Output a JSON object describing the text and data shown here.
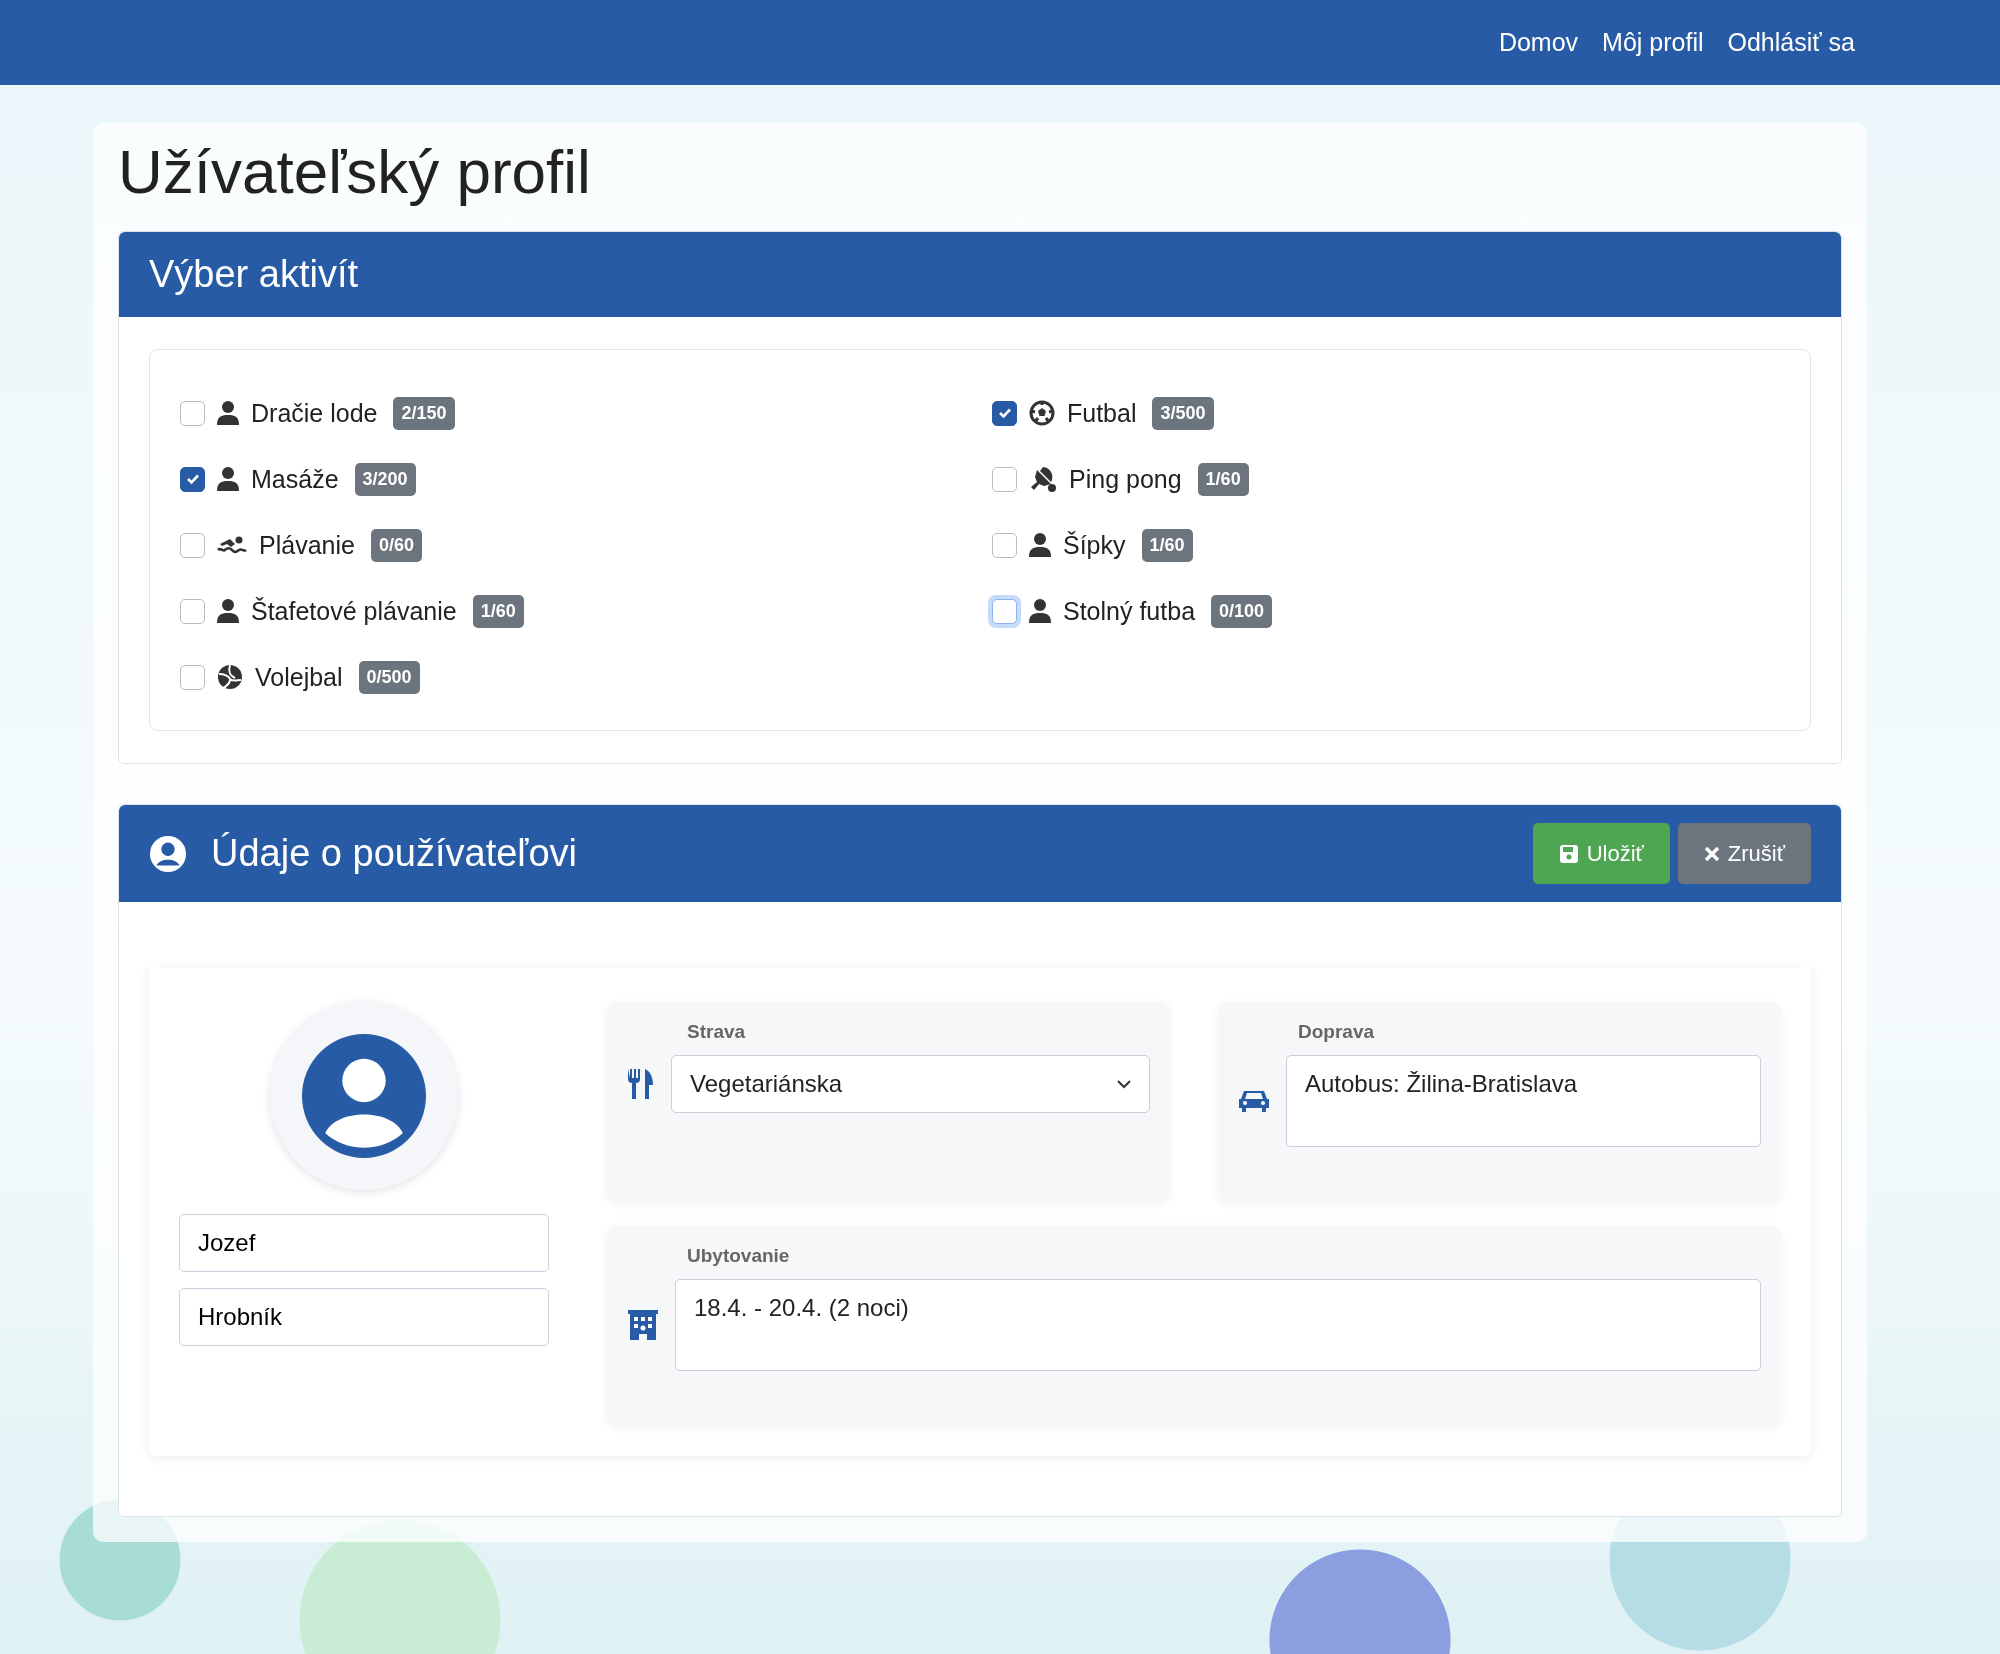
{
  "navbar": {
    "links": [
      "Domov",
      "Môj profil",
      "Odhlásiť sa"
    ]
  },
  "page_title": "Užívateľský profil",
  "activities_section": {
    "title": "Výber aktivít",
    "columns": [
      [
        {
          "label": "Dračie lode",
          "kind": "person",
          "count": "2/150",
          "checked": false,
          "focused": false
        },
        {
          "label": "Masáže",
          "kind": "person",
          "count": "3/200",
          "checked": true,
          "focused": false
        },
        {
          "label": "Plávanie",
          "kind": "swim",
          "count": "0/60",
          "checked": false,
          "focused": false
        },
        {
          "label": "Štafetové plávanie",
          "kind": "person",
          "count": "1/60",
          "checked": false,
          "focused": false
        },
        {
          "label": "Volejbal",
          "kind": "volleyball",
          "count": "0/500",
          "checked": false,
          "focused": false
        }
      ],
      [
        {
          "label": "Futbal",
          "kind": "soccer",
          "count": "3/500",
          "checked": true,
          "focused": false
        },
        {
          "label": "Ping pong",
          "kind": "pingpong",
          "count": "1/60",
          "checked": false,
          "focused": false
        },
        {
          "label": "Šípky",
          "kind": "person",
          "count": "1/60",
          "checked": false,
          "focused": false
        },
        {
          "label": "Stolný futba",
          "kind": "person",
          "count": "0/100",
          "checked": false,
          "focused": true
        }
      ]
    ]
  },
  "user_section": {
    "title": "Údaje o používateľovi",
    "save_button": "Uložiť",
    "cancel_button": "Zrušiť",
    "first_name": "Jozef",
    "last_name": "Hrobník",
    "diet": {
      "label": "Strava",
      "value": "Vegetariánska"
    },
    "transport": {
      "label": "Doprava",
      "value": "Autobus: Žilina-Bratislava"
    },
    "accommodation": {
      "label": "Ubytovanie",
      "value": "18.4. - 20.4. (2 noci)"
    }
  }
}
